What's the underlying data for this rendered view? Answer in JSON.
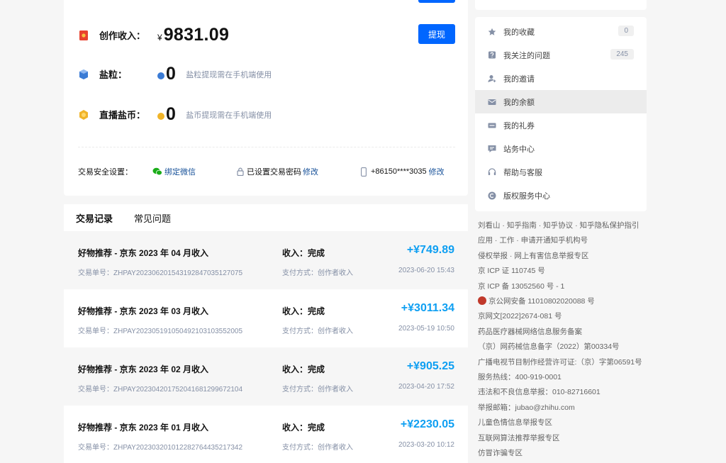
{
  "wallet": {
    "withdraw_button": "提现",
    "creation_income": {
      "label": "创作收入：",
      "currency": "¥",
      "amount": "9831.09"
    },
    "salt_grain": {
      "label": "盐粒：",
      "amount": "0",
      "note": "盐粒提现需在手机端使用"
    },
    "live_coin": {
      "label": "直播盐币：",
      "amount": "0",
      "note": "盐币提现需在手机端使用"
    },
    "security": {
      "label": "交易安全设置：",
      "wechat": "绑定微信",
      "password_set": "已设置交易密码",
      "password_modify": "修改",
      "phone": "+86150****3035",
      "phone_modify": "修改"
    }
  },
  "tabs": [
    "交易记录",
    "常见问题"
  ],
  "transactions": [
    {
      "title": "好物推荐 - 京东 2023 年 04 月收入",
      "id": "交易单号：ZHPAY20230620154319284703512707​5",
      "status": "收入：完成",
      "method": "支付方式：创作者收入",
      "amount": "+¥749.89",
      "date": "2023-06-20 15:43"
    },
    {
      "title": "好物推荐 - 京东 2023 年 03 月收入",
      "id": "交易单号：ZHPAY20230519105049210310355200​5",
      "status": "收入：完成",
      "method": "支付方式：创作者收入",
      "amount": "+¥3011.34",
      "date": "2023-05-19 10:50"
    },
    {
      "title": "好物推荐 - 京东 2023 年 02 月收入",
      "id": "交易单号：ZHPAY20230420175204168129967210​4",
      "status": "收入：完成",
      "method": "支付方式：创作者收入",
      "amount": "+¥905.25",
      "date": "2023-04-20 17:52"
    },
    {
      "title": "好物推荐 - 京东 2023 年 01 月收入",
      "id": "交易单号：ZHPAY20230320101228276443521734​2",
      "status": "收入：完成",
      "method": "支付方式：创作者收入",
      "amount": "+¥2230.05",
      "date": "2023-03-20 10:12"
    }
  ],
  "sidebar": {
    "items": [
      {
        "label": "我的收藏",
        "badge": "0",
        "icon": "star-icon"
      },
      {
        "label": "我关注的问题",
        "badge": "245",
        "icon": "question-icon"
      },
      {
        "label": "我的邀请",
        "badge": "",
        "icon": "invite-icon"
      },
      {
        "label": "我的余额",
        "badge": "",
        "icon": "balance-icon"
      },
      {
        "label": "我的礼券",
        "badge": "",
        "icon": "coupon-icon"
      },
      {
        "label": "站务中心",
        "badge": "",
        "icon": "site-center-icon"
      },
      {
        "label": "帮助与客服",
        "badge": "",
        "icon": "headset-icon"
      },
      {
        "label": "版权服务中心",
        "badge": "",
        "icon": "copyright-icon"
      }
    ]
  },
  "footer": [
    "刘看山 · 知乎指南 · 知乎协议 · 知乎隐私保护指引",
    "应用 · 工作 · 申请开通知乎机构号",
    "侵权举报 · 网上有害信息举报专区",
    "京 ICP 证 110745 号",
    "京 ICP 备 13052560 号 - 1",
    "京公网安备 11010802020088 号",
    "京网文[2022]2674-081 号",
    "药品医疗器械网络信息服务备案",
    "（京）网药械信息备字（2022）第00334号",
    "广播电视节目制作经营许可证:（京）字第06591号",
    "服务热线：400-919-0001",
    "违法和不良信息举报：010-82716601",
    "举报邮箱：jubao@zhihu.com",
    "儿童色情信息举报专区",
    "互联网算法推荐举报专区",
    "仿冒诈骗专区"
  ],
  "colors": {
    "accent": "#0066ff",
    "amount": "#0e9ff2",
    "link": "#175199"
  }
}
